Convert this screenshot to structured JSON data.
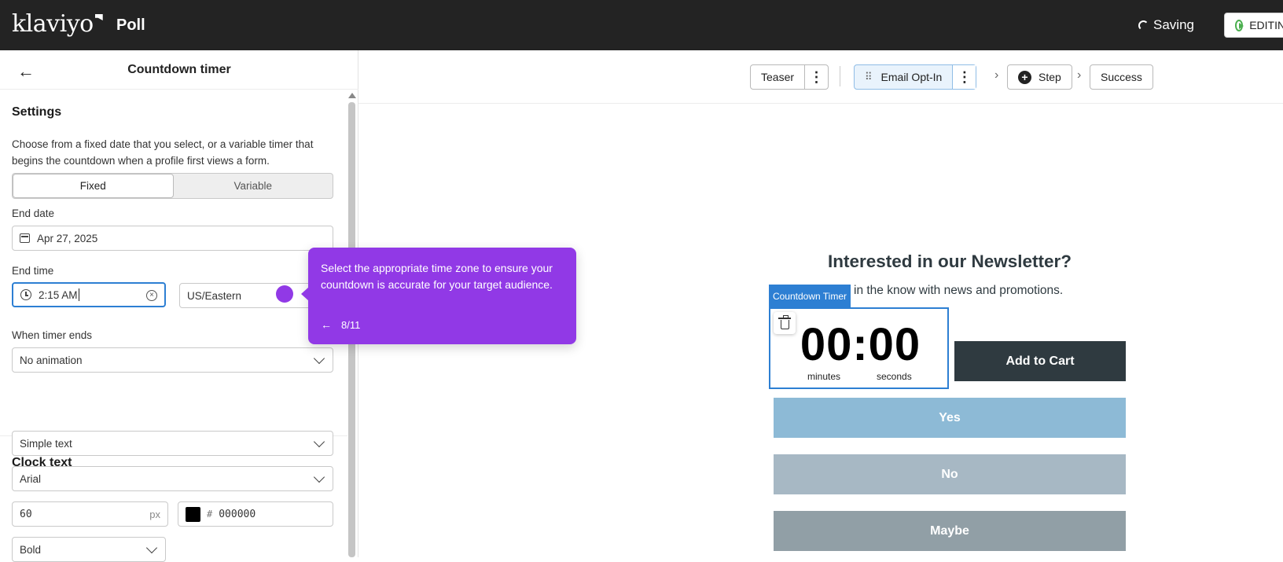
{
  "topbar": {
    "logo": "klaviyo",
    "app_title": "Poll",
    "status": "Saving",
    "edit_label": "EDITING"
  },
  "panel": {
    "title": "Countdown timer",
    "settings_heading": "Settings",
    "description": "Choose from a fixed date that you select, or a variable timer that begins the countdown when a profile first views a form.",
    "mode_options": [
      "Fixed",
      "Variable"
    ],
    "mode_selected": "Fixed",
    "end_date_label": "End date",
    "end_date_value": "Apr 27, 2025",
    "end_time_label": "End time",
    "end_time_value": "2:15 AM",
    "timezone_value": "US/Eastern",
    "timer_ends_label": "When timer ends",
    "timer_ends_value": "No animation",
    "clock_heading": "Clock text",
    "text_style_value": "Simple text",
    "font_value": "Arial",
    "font_size_value": "60",
    "font_size_unit": "px",
    "color_hash": "#",
    "color_value": "000000",
    "weight_value": "Bold"
  },
  "tooltip": {
    "text": "Select the appropriate time zone to ensure your countdown is accurate for your target audience.",
    "progress": "8/11"
  },
  "steps": {
    "teaser": "Teaser",
    "email_optin": "Email Opt-In",
    "step": "Step",
    "success": "Success"
  },
  "form": {
    "title": "Interested in our Newsletter?",
    "subtitle": "in the know with news and promotions.",
    "timer_label": "Countdown Timer",
    "timer_digits": "00:00",
    "minutes_label": "minutes",
    "seconds_label": "seconds",
    "cart_button": "Add to Cart",
    "options": [
      "Yes",
      "No",
      "Maybe"
    ]
  },
  "colors": {
    "accent": "#9139e6",
    "selection": "#2d7fd3",
    "opt_yes": "#8dbad6",
    "opt_no": "#a7b8c4",
    "opt_maybe": "#919fa6",
    "cart": "#2f3a40"
  }
}
